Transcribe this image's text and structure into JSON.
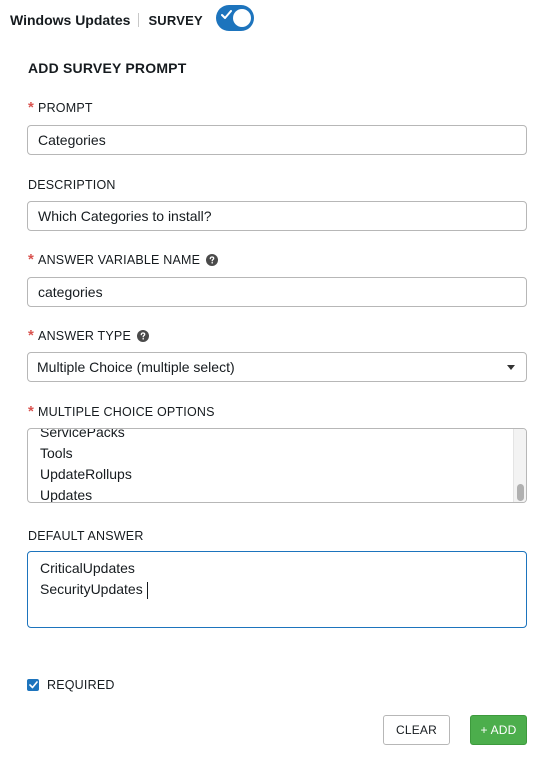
{
  "header": {
    "title": "Windows Updates",
    "subtitle": "SURVEY",
    "toggle_on": true
  },
  "form": {
    "section_title": "ADD SURVEY PROMPT",
    "prompt": {
      "label": "PROMPT",
      "required": true,
      "value": "Categories"
    },
    "description": {
      "label": "DESCRIPTION",
      "required": false,
      "value": "Which Categories to install?"
    },
    "variable_name": {
      "label": "ANSWER VARIABLE NAME",
      "required": true,
      "value": "categories"
    },
    "answer_type": {
      "label": "ANSWER TYPE",
      "required": true,
      "selected": "Multiple Choice (multiple select)"
    },
    "choice_options": {
      "label": "MULTIPLE CHOICE OPTIONS",
      "required": true,
      "visible_lines": [
        "ServicePacks",
        "Tools",
        "UpdateRollups",
        "Updates"
      ]
    },
    "default_answer": {
      "label": "DEFAULT ANSWER",
      "lines": [
        "CriticalUpdates",
        "SecurityUpdates"
      ]
    },
    "required_checkbox": {
      "label": "REQUIRED",
      "checked": true
    }
  },
  "buttons": {
    "clear": "CLEAR",
    "add": "+ ADD"
  },
  "icons": {
    "toggle_check": "check-icon",
    "help": "question-circle-icon",
    "select_caret": "caret-down-icon"
  },
  "colors": {
    "accent": "#1d74bd",
    "required_star": "#d9534f",
    "add_button": "#4cae4c"
  }
}
